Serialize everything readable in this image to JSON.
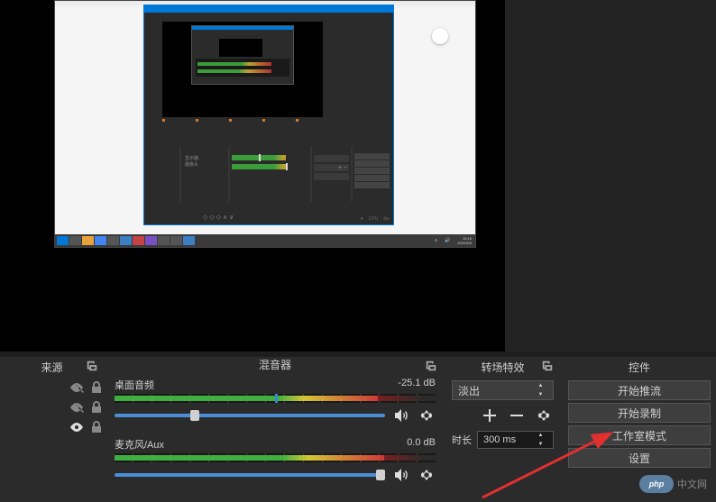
{
  "panels": {
    "sources": {
      "title": "来源"
    },
    "mixer": {
      "title": "混音器"
    },
    "transitions": {
      "title": "转场特效"
    },
    "controls": {
      "title": "控件"
    }
  },
  "mixer": {
    "channel1": {
      "name": "桌面音频",
      "level": "-25.1 dB"
    },
    "channel2": {
      "name": "麦克风/Aux",
      "level": "0.0 dB"
    }
  },
  "transitions": {
    "selected": "淡出",
    "duration_label": "时长",
    "duration_value": "300 ms"
  },
  "controls": {
    "start_stream": "开始推流",
    "start_record": "开始录制",
    "studio_mode": "工作室模式",
    "settings": "设置"
  },
  "nested": {
    "source_items": [
      "显示器",
      "摄像头"
    ],
    "taskbar_time": "15:18",
    "taskbar_date": "2020/6/6"
  },
  "watermark": {
    "logo": "php",
    "text": "中文网"
  }
}
